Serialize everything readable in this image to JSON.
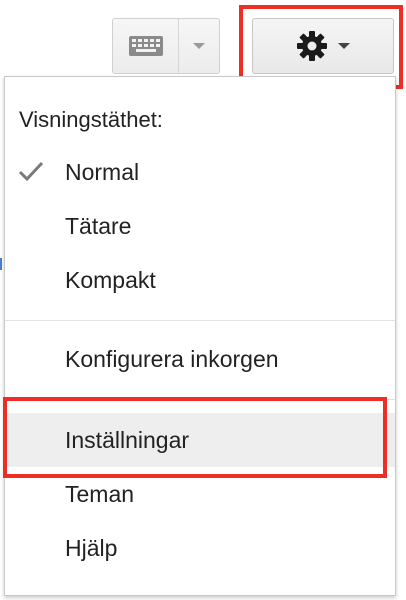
{
  "toolbar": {
    "keyboard_icon": "keyboard-icon",
    "dropdown_icon": "chevron-down-icon",
    "settings_icon": "gear-icon"
  },
  "menu": {
    "heading": "Visningstäthet:",
    "density_options": [
      {
        "label": "Normal",
        "selected": true
      },
      {
        "label": "Tätare",
        "selected": false
      },
      {
        "label": "Kompakt",
        "selected": false
      }
    ],
    "configure_inbox": "Konfigurera inkorgen",
    "items": [
      {
        "label": "Inställningar",
        "highlighted": true
      },
      {
        "label": "Teman",
        "highlighted": false
      },
      {
        "label": "Hjälp",
        "highlighted": false
      }
    ]
  },
  "colors": {
    "highlight_box": "#ee2d24",
    "hover_row": "#eeeeee",
    "text": "#222222"
  }
}
